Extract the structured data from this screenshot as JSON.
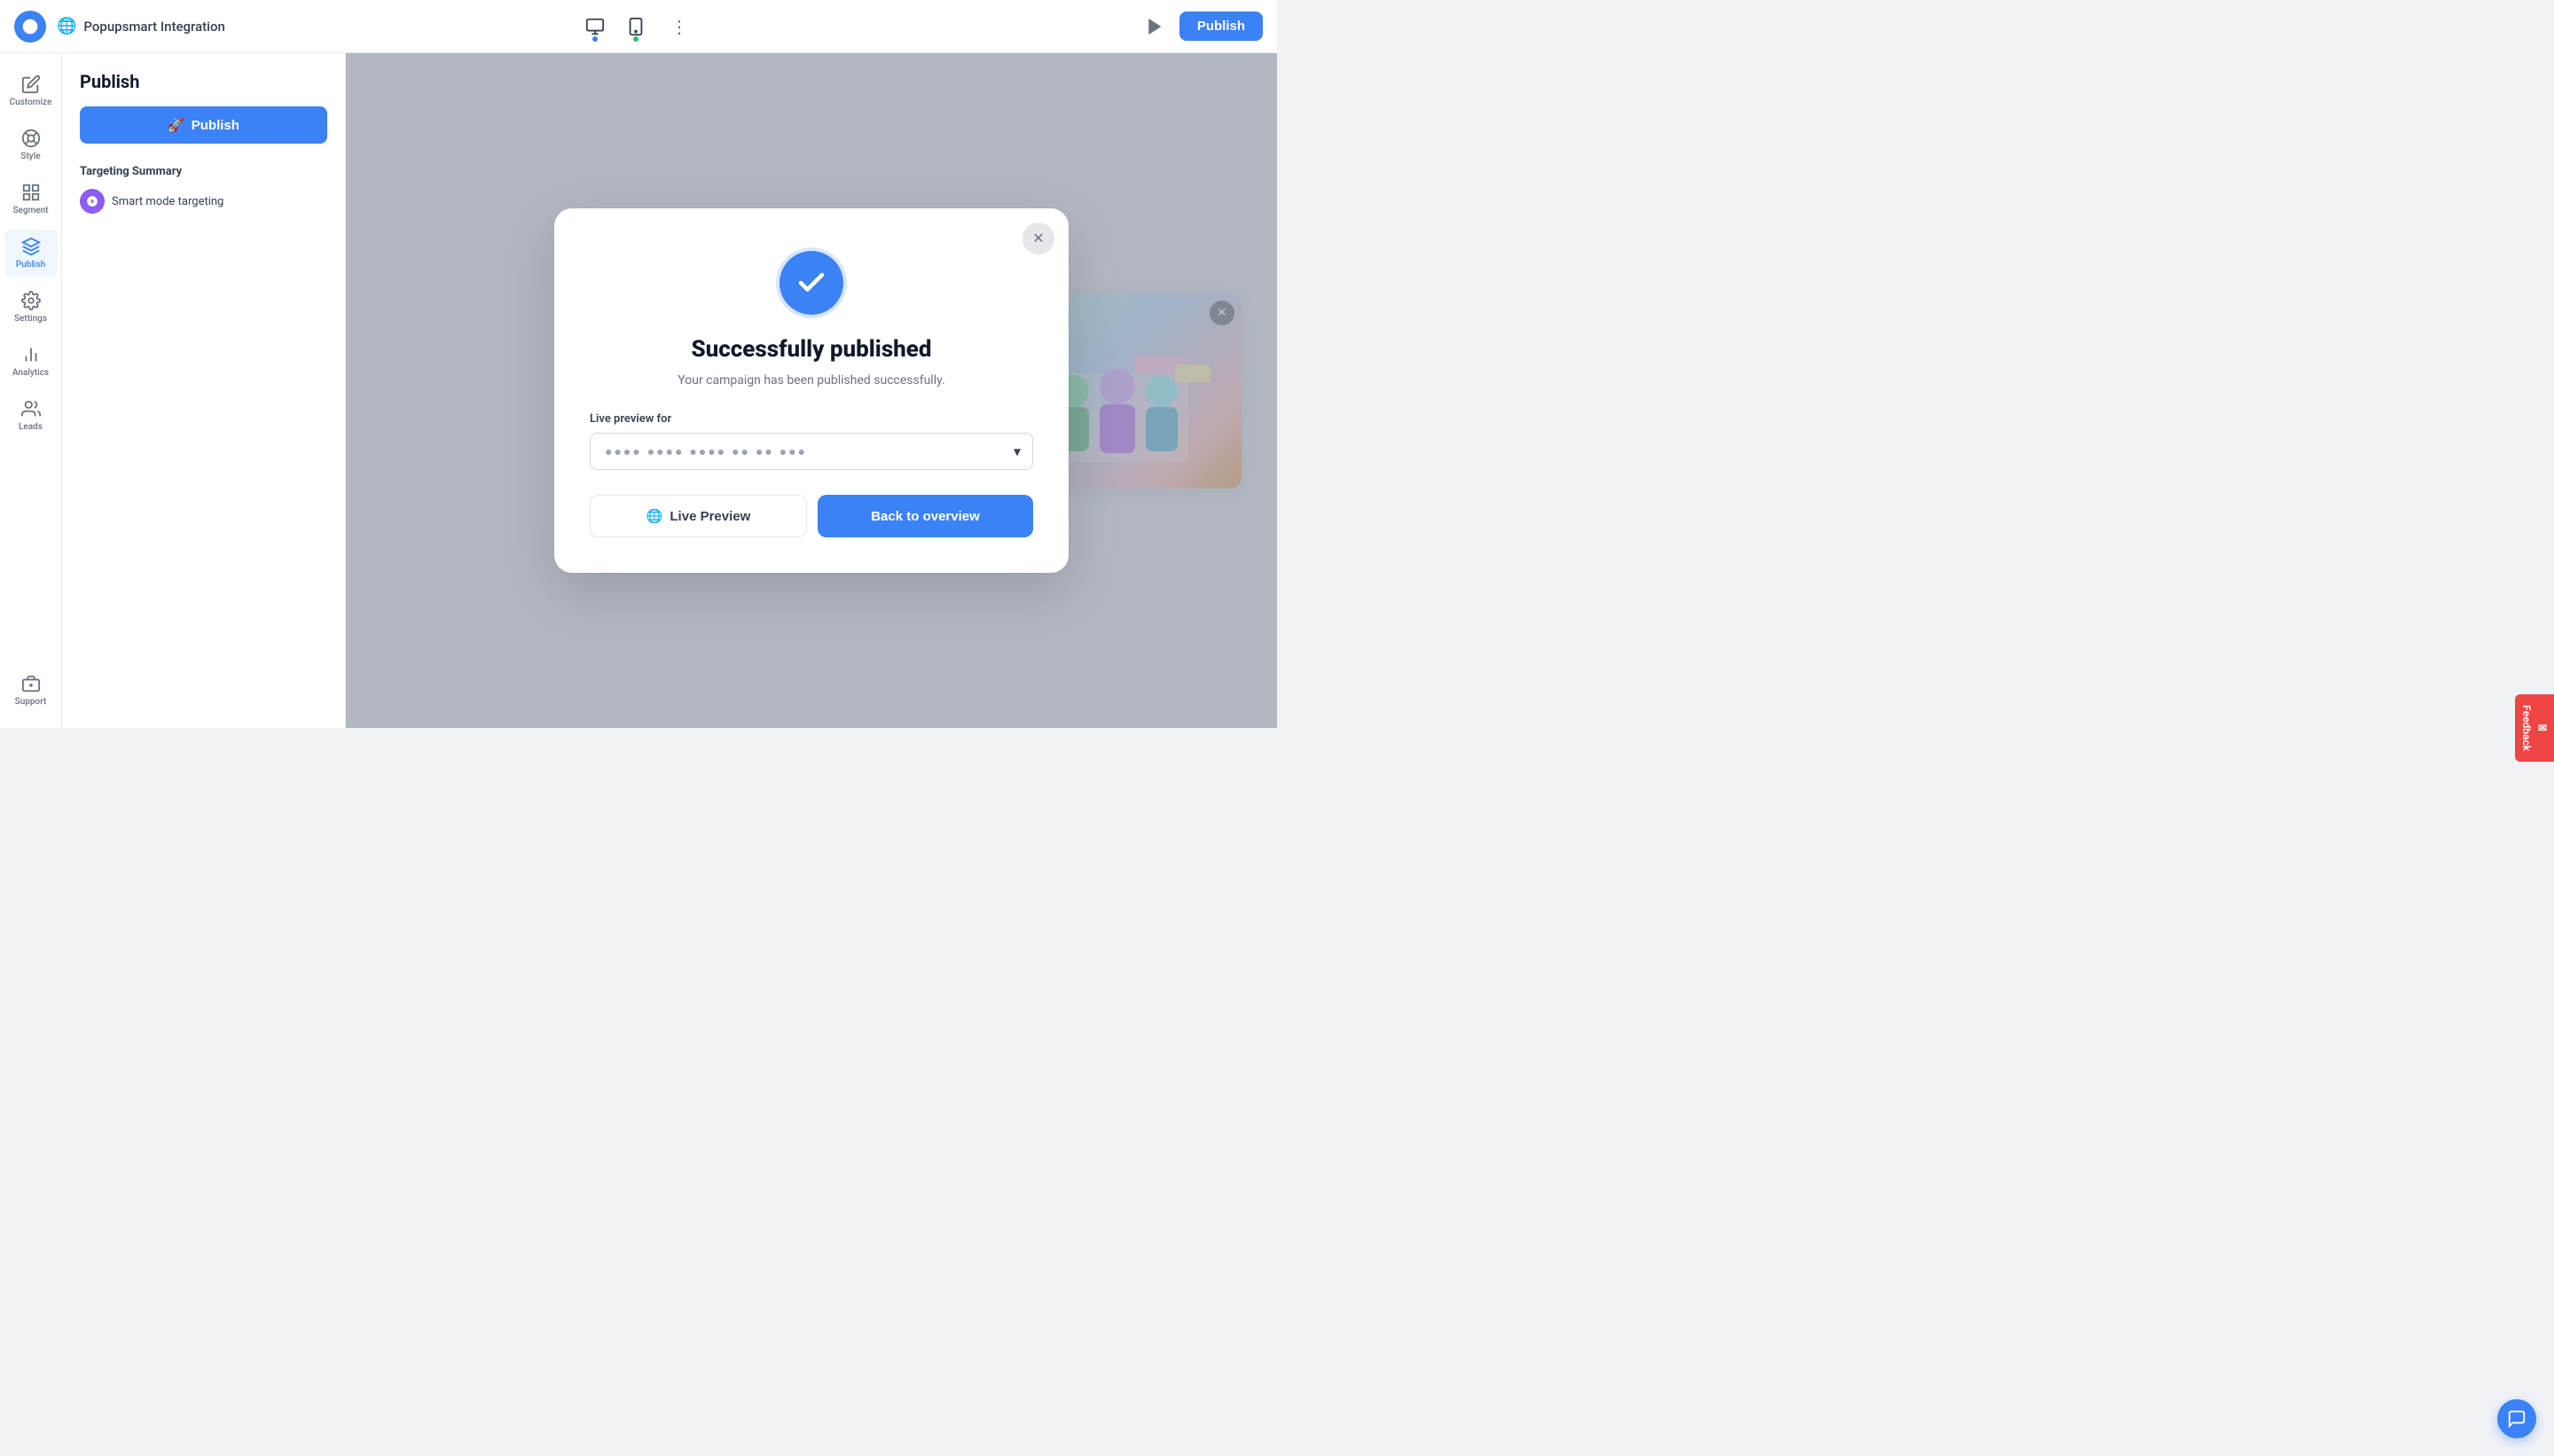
{
  "header": {
    "title": "Popupsmart Integration",
    "publish_label": "Publish",
    "play_label": "Play"
  },
  "sidebar": {
    "items": [
      {
        "id": "customize",
        "label": "Customize",
        "icon": "edit"
      },
      {
        "id": "style",
        "label": "Style",
        "icon": "palette"
      },
      {
        "id": "segment",
        "label": "Segment",
        "icon": "grid"
      },
      {
        "id": "publish",
        "label": "Publish",
        "icon": "rocket",
        "active": true
      },
      {
        "id": "settings",
        "label": "Settings",
        "icon": "settings"
      },
      {
        "id": "analytics",
        "label": "Analytics",
        "icon": "chart"
      },
      {
        "id": "leads",
        "label": "Leads",
        "icon": "users"
      }
    ],
    "bottom_item": {
      "id": "support",
      "label": "Support",
      "icon": "briefcase"
    }
  },
  "left_panel": {
    "title": "Publish",
    "publish_btn_label": "Publish",
    "targeting_title": "Targeting Summary",
    "targeting_item": "Smart mode targeting"
  },
  "modal": {
    "title": "Successfully published",
    "description": "Your campaign has been published successfully.",
    "live_preview_label": "Live preview for",
    "select_placeholder": "●●●● ●●●● ●●●● ●● ●● ●●●",
    "live_preview_btn": "Live Preview",
    "back_overview_btn": "Back to overview"
  },
  "feedback": {
    "label": "Feedback"
  },
  "colors": {
    "primary": "#3b82f6",
    "danger": "#ef4444"
  }
}
